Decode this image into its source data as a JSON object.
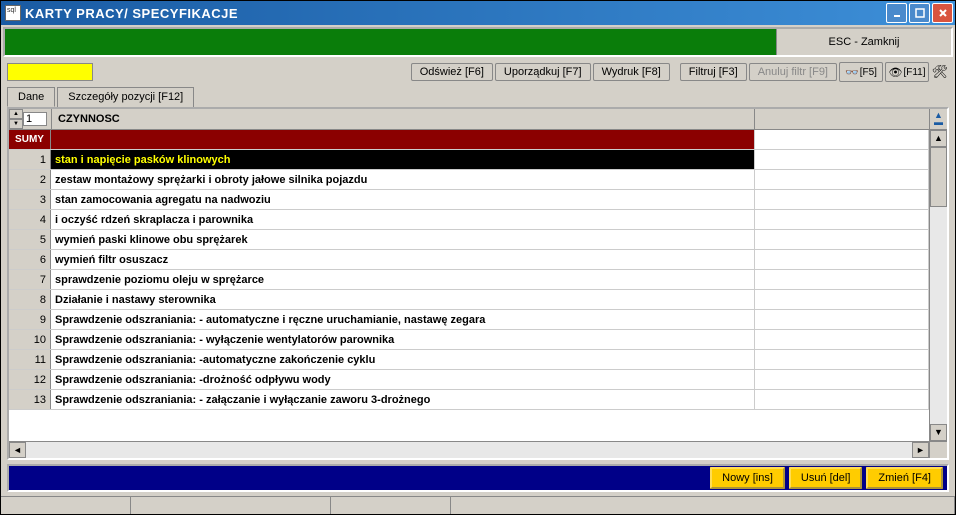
{
  "window": {
    "title": "KARTY PRACY/ SPECYFIKACJE",
    "sql_icon_text": "sql"
  },
  "top_band": {
    "esc_label": "ESC - Zamknij"
  },
  "toolbar": {
    "refresh": "Odśwież [F6]",
    "sort": "Uporządkuj [F7]",
    "print": "Wydruk [F8]",
    "filter": "Filtruj [F3]",
    "cancel_filter": "Anuluj filtr [F9]",
    "f5": "[F5]",
    "f11": "[F11]"
  },
  "tabs": {
    "tab1": "Dane",
    "tab2": "Szczegóły pozycji [F12]"
  },
  "grid": {
    "header": "CZYNNOSC",
    "current_row": "1",
    "sumy_label": "SUMY",
    "rows": [
      {
        "n": "1",
        "text": "stan i napięcie pasków klinowych",
        "selected": true
      },
      {
        "n": "2",
        "text": "zestaw montażowy sprężarki i obroty jałowe silnika pojazdu"
      },
      {
        "n": "3",
        "text": "stan zamocowania agregatu na nadwoziu"
      },
      {
        "n": "4",
        "text": "i oczyść rdzeń skraplacza i parownika"
      },
      {
        "n": "5",
        "text": "wymień paski klinowe obu sprężarek"
      },
      {
        "n": "6",
        "text": "wymień filtr osuszacz"
      },
      {
        "n": "7",
        "text": "sprawdzenie poziomu oleju w sprężarce"
      },
      {
        "n": "8",
        "text": "Działanie i nastawy sterownika"
      },
      {
        "n": "9",
        "text": "Sprawdzenie odszraniania:  - automatyczne i ręczne uruchamianie, nastawę zegara"
      },
      {
        "n": "10",
        "text": "Sprawdzenie odszraniania:  - wyłączenie wentylatorów parownika"
      },
      {
        "n": "11",
        "text": "Sprawdzenie odszraniania: -automatyczne zakończenie cyklu"
      },
      {
        "n": "12",
        "text": "Sprawdzenie odszraniania: -drożność odpływu wody"
      },
      {
        "n": "13",
        "text": "Sprawdzenie odszraniania:  - załączanie i wyłączanie zaworu 3-drożnego"
      }
    ]
  },
  "bottom": {
    "new": "Nowy [ins]",
    "delete": "Usuń [del]",
    "edit": "Zmień [F4]"
  },
  "status": {
    "s1": "",
    "s2": "",
    "s3": "",
    "s4": ""
  }
}
